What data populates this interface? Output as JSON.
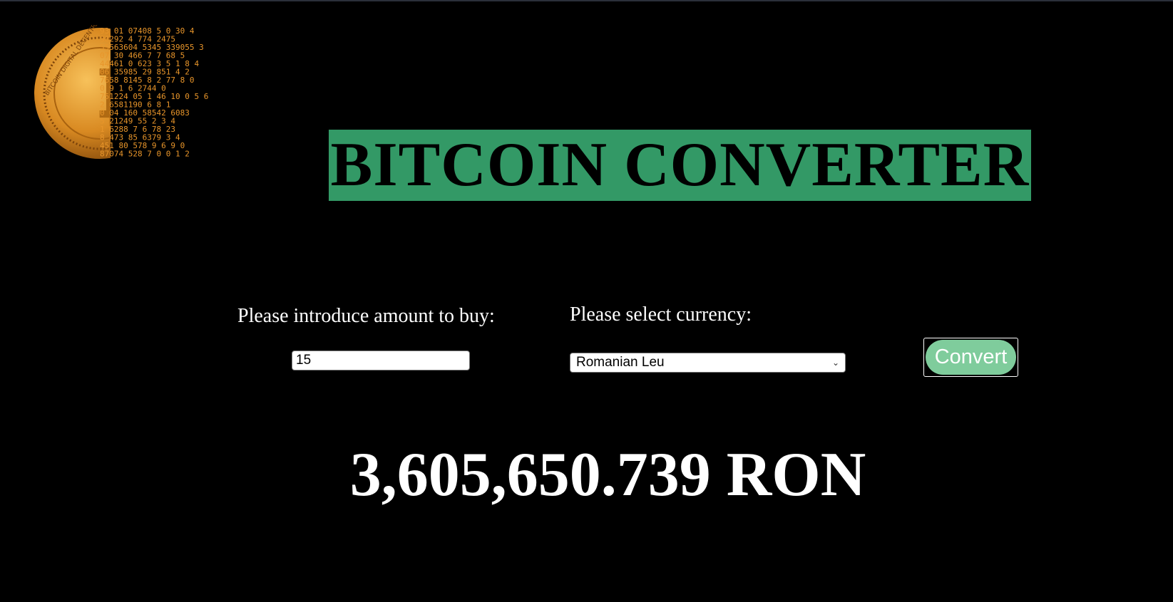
{
  "header": {
    "title": "BITCOIN CONVERTER",
    "title_bg_color": "#339966"
  },
  "logo": {
    "icon": "bitcoin-digital-coin-icon",
    "coin_text": "BITCOIN DIGITAL DECENTRALIZED",
    "digit_rows": [
      "93 01 07408  5  0  30     4",
      "30292 4   774   2475",
      "55563604 5345  339055   3",
      "07  30 466 7 7  68      5",
      "44461 0 623   3 5  1  8 4",
      "06 35985 29     851 4   2",
      "7658  8145 8 2   77 8 0",
      " 0 9  1   6 2744  0",
      "751224 05 1 46   10    0 5 6",
      "2 6581190   6  8      1",
      "0  04 160 58542  6083",
      "5  21249 55   2  3   4",
      "1  6288    7 6  78    23",
      "8 473 85 6379     3   4",
      "451 80 578 9 6 9 0",
      "87074 528 7 0 0   1    2"
    ],
    "accent_color": "#e8952a"
  },
  "form": {
    "amount_label": "Please introduce amount to buy:",
    "amount_value": "15",
    "currency_label": "Please select currency:",
    "currency_selected": "Romanian Leu",
    "convert_label": "Convert",
    "convert_color": "#7fcc9c"
  },
  "result": {
    "text": "3,605,650.739 RON"
  }
}
